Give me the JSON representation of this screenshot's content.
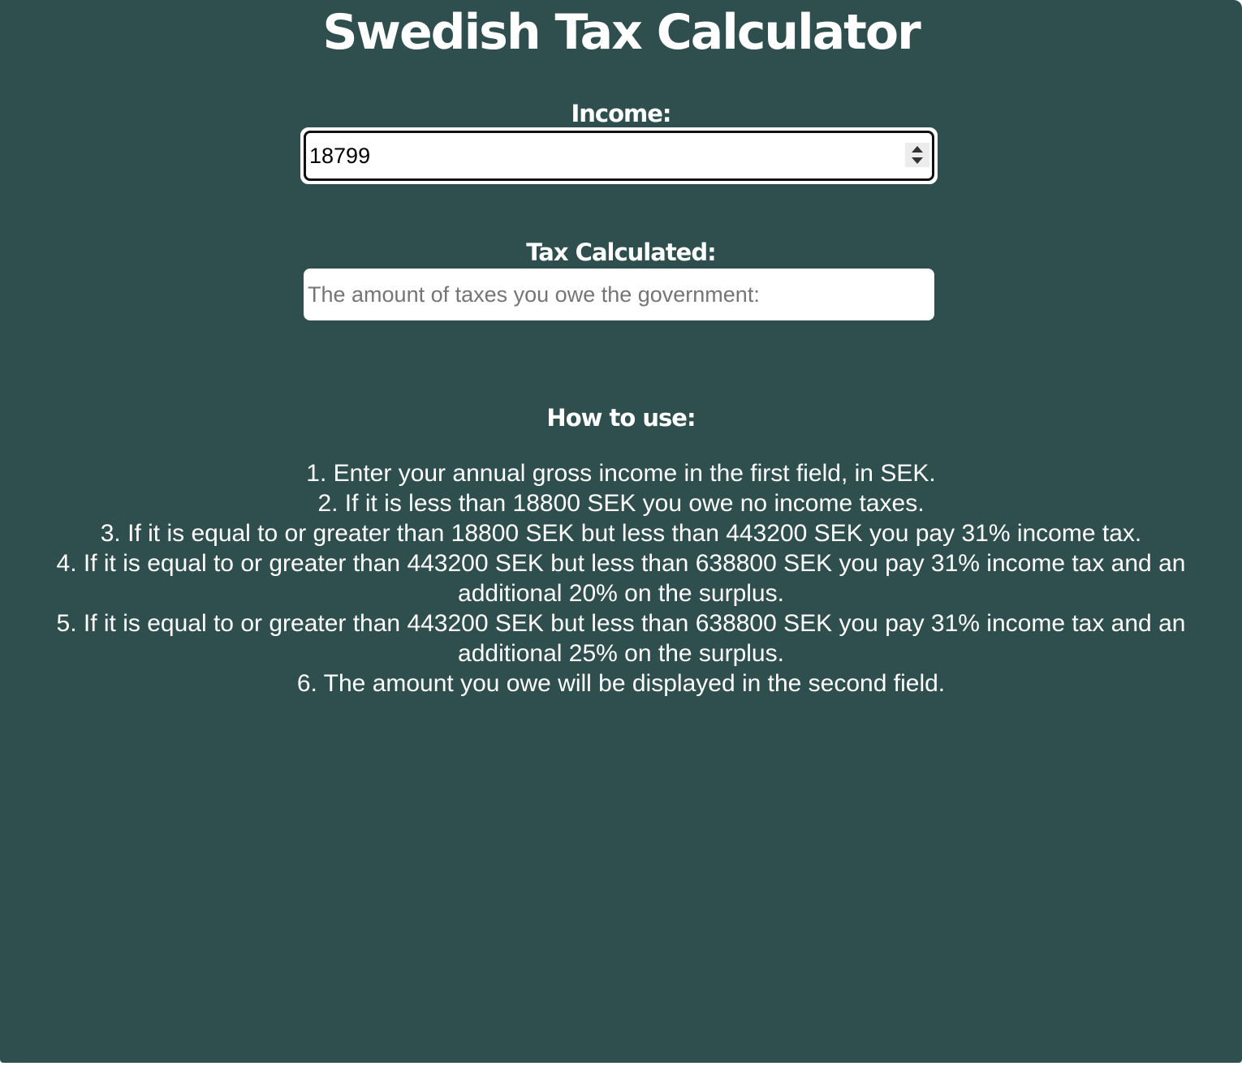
{
  "title": "Swedish Tax Calculator",
  "income": {
    "label": "Income:",
    "value": "18799"
  },
  "tax": {
    "label": "Tax Calculated:",
    "placeholder": "The amount of taxes you owe the government:"
  },
  "howto": {
    "title": "How to use:",
    "steps": [
      "1. Enter your annual gross income in the first field, in SEK.",
      "2. If it is less than 18800 SEK you owe no income taxes.",
      "3. If it is equal to or greater than 18800 SEK but less than 443200 SEK you pay 31% income tax.",
      "4. If it is equal to or greater than 443200 SEK but less than 638800 SEK you pay 31% income tax and an additional 20% on the surplus.",
      "5. If it is equal to or greater than 443200 SEK but less than 638800 SEK you pay 31% income tax and an additional 25% on the surplus.",
      "6. The amount you owe will be displayed in the second field."
    ]
  },
  "colors": {
    "background": "#2f4f4f",
    "text": "#ffffff"
  }
}
